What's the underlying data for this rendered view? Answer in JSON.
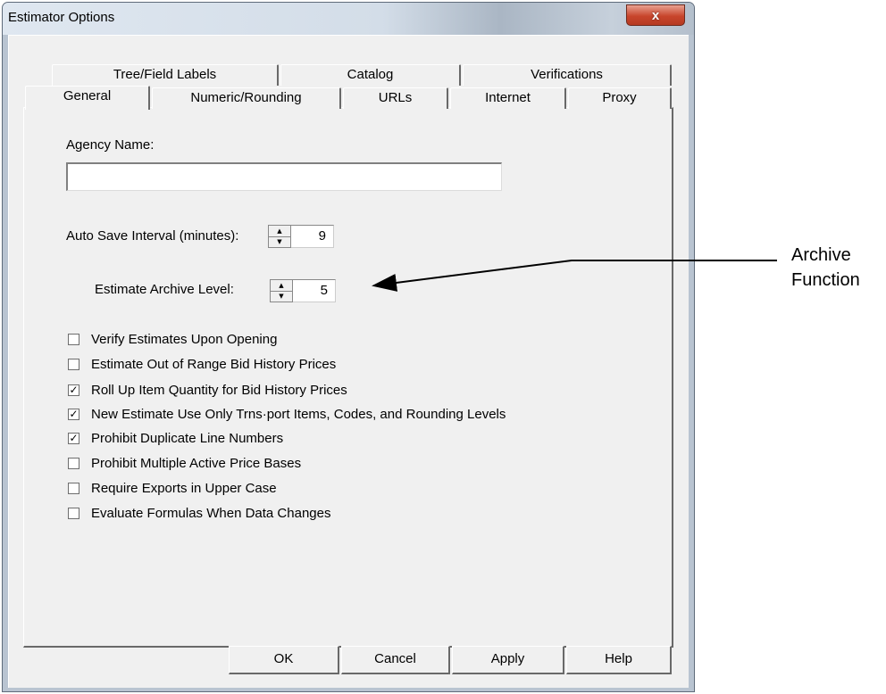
{
  "window": {
    "title": "Estimator Options",
    "close_glyph": "x"
  },
  "tabs": {
    "back_row": [
      {
        "label": "Tree/Field Labels"
      },
      {
        "label": "Catalog"
      },
      {
        "label": "Verifications"
      }
    ],
    "front_row": [
      {
        "label": "General",
        "active": true
      },
      {
        "label": "Numeric/Rounding"
      },
      {
        "label": "URLs"
      },
      {
        "label": "Internet"
      },
      {
        "label": "Proxy"
      }
    ]
  },
  "general": {
    "agency_name_label": "Agency Name:",
    "agency_name_value": "",
    "auto_save_label": "Auto Save Interval (minutes):",
    "auto_save_value": "9",
    "archive_level_label": "Estimate Archive Level:",
    "archive_level_value": "5",
    "checkboxes": [
      {
        "label": "Verify Estimates Upon Opening",
        "checked": false
      },
      {
        "label": "Estimate Out of Range Bid History Prices",
        "checked": false
      },
      {
        "label": "Roll Up Item Quantity for Bid History Prices",
        "checked": true
      },
      {
        "label": "New Estimate Use Only Trns·port Items, Codes, and Rounding Levels",
        "checked": true
      },
      {
        "label": "Prohibit Duplicate Line Numbers",
        "checked": true
      },
      {
        "label": "Prohibit Multiple Active Price Bases",
        "checked": false
      },
      {
        "label": "Require Exports in Upper Case",
        "checked": false
      },
      {
        "label": "Evaluate Formulas When Data Changes",
        "checked": false
      }
    ]
  },
  "buttons": {
    "ok": "OK",
    "cancel": "Cancel",
    "apply": "Apply",
    "help": "Help"
  },
  "annotation": {
    "line1": "Archive",
    "line2": "Function"
  }
}
